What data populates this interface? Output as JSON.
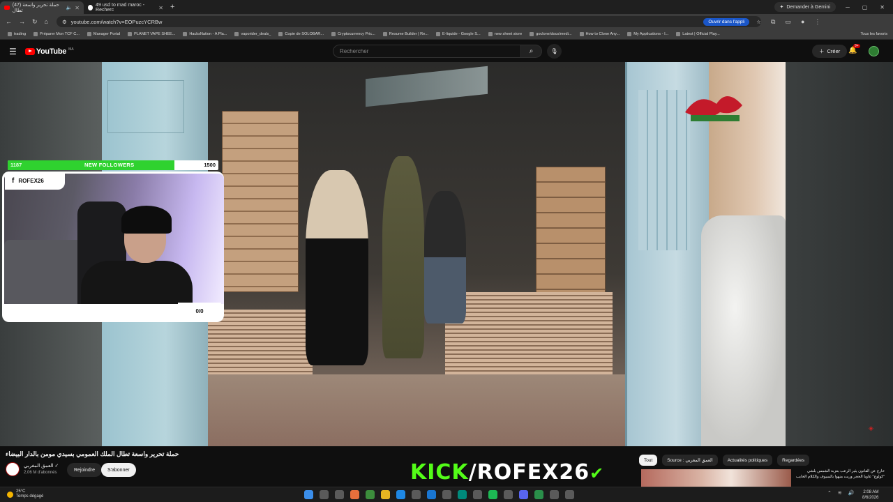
{
  "browser": {
    "tabs": [
      {
        "label": "(47) حملة تحرير واسعة تطال",
        "active": true
      },
      {
        "label": "49 usd to mad maroc - Recherc",
        "active": false
      }
    ],
    "gemini_label": "Demander à Gemini",
    "url": "youtube.com/watch?v=EOPuzcYCRBw",
    "open_app_label": "Ouvrir dans l'appli",
    "bookmarks": [
      "trading",
      "Préparer Mon TCF C...",
      "Manager Portal",
      "PLANET VAPE SHEE...",
      "HacksNation - A Pla...",
      "vaporider_deals_",
      "Copie de SOLOBAR...",
      "Cryptocurrency Pric...",
      "Resume Builder | Re...",
      "E-liquide - Google S...",
      "new sheet store",
      "goclone/docs/medi...",
      "How to Clone Any...",
      "My Applications - I...",
      "Latest | Official Play..."
    ],
    "bookmarks_right": "Tous les favoris"
  },
  "youtube": {
    "logo": "YouTube",
    "region": "MA",
    "search_placeholder": "Rechercher",
    "create_label": "Créer",
    "notification_count": "9+"
  },
  "overlay": {
    "current": "1187",
    "label": "NEW FOLLOWERS",
    "target": "1500",
    "progress": 0.79,
    "cam_handle": "ROFEX26",
    "cam_count": "0/0"
  },
  "video": {
    "title": "حملة تحرير واسعة تطال الملك العمومي بسيدي مومن بالدار البيضاء",
    "channel_name": "العمق المغربي",
    "subscribers": "2,06 M d'abonnés",
    "join_label": "Rejoindre",
    "subscribe_label": "S'abonner"
  },
  "banner": {
    "kick": "KICK",
    "slash": "/",
    "name": "ROFEX26"
  },
  "recommendations": {
    "chips": [
      "Tout",
      "Source : العمق المغربي",
      "Actualités politiques",
      "Regardées"
    ],
    "first_title": "خارج عن القانون يثير الرعب بعزبة الشمس بلشي \"كولوج\" عاوبا الحجر وريت منهوا بالسيوف والكلام الخايب"
  },
  "taskbar": {
    "temp": "25°C",
    "weather": "Temps dégagé",
    "time": "2:08 AM",
    "date": "8/6/2026"
  }
}
